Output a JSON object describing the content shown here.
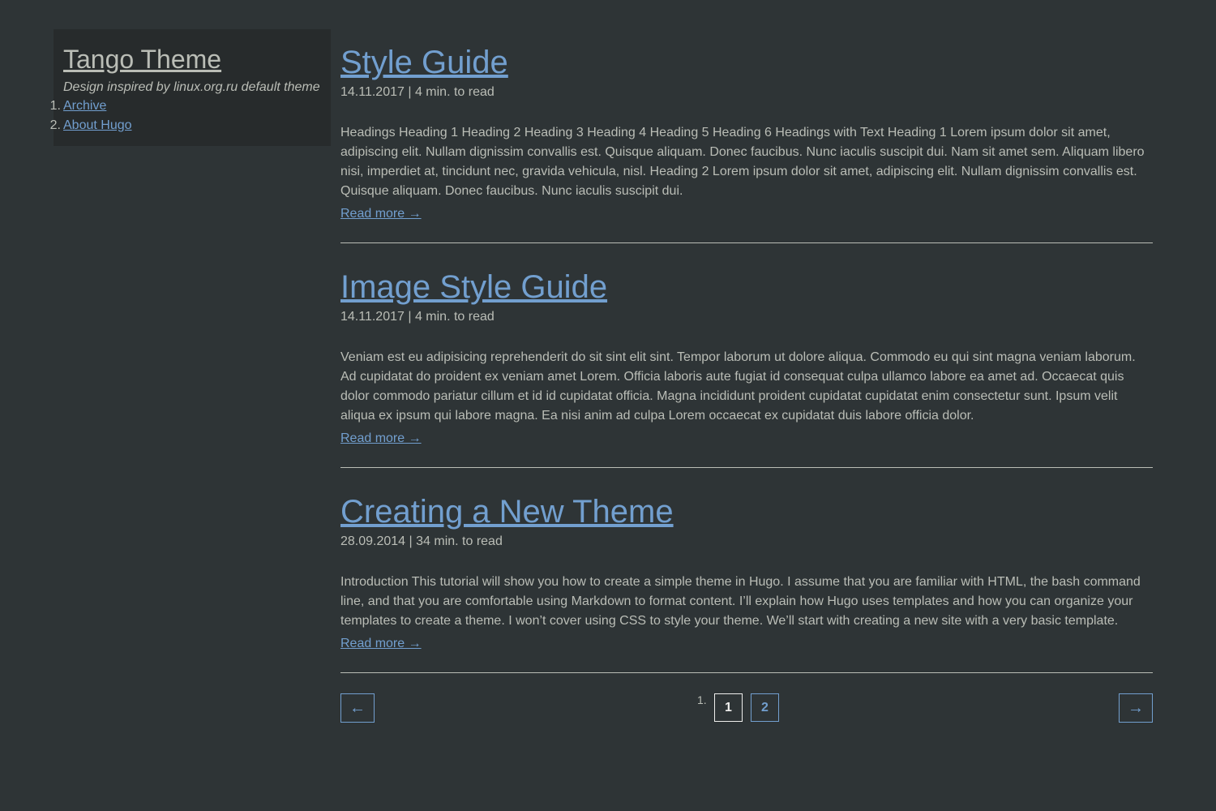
{
  "sidebar": {
    "title": "Tango Theme",
    "description": "Design inspired by linux.org.ru default theme",
    "nav": [
      {
        "number": "1.",
        "label": "Archive"
      },
      {
        "number": "2.",
        "label": "About Hugo"
      }
    ]
  },
  "posts": [
    {
      "title": "Style Guide",
      "meta": "14.11.2017 | 4 min. to read",
      "excerpt": "Headings Heading 1 Heading 2 Heading 3 Heading 4 Heading 5 Heading 6 Headings with Text Heading 1 Lorem ipsum dolor sit amet, adipiscing elit. Nullam dignissim convallis est. Quisque aliquam. Donec faucibus. Nunc iaculis suscipit dui. Nam sit amet sem. Aliquam libero nisi, imperdiet at, tincidunt nec, gravida vehicula, nisl. Heading 2 Lorem ipsum dolor sit amet, adipiscing elit. Nullam dignissim convallis est. Quisque aliquam. Donec faucibus. Nunc iaculis suscipit dui.",
      "read_more": "Read more →"
    },
    {
      "title": "Image Style Guide",
      "meta": "14.11.2017 | 4 min. to read",
      "excerpt": "Veniam est eu adipisicing reprehenderit do sit sint elit sint. Tempor laborum ut dolore aliqua. Commodo eu qui sint magna veniam laborum. Ad cupidatat do proident ex veniam amet Lorem. Officia laboris aute fugiat id consequat culpa ullamco labore ea amet ad. Occaecat quis dolor commodo pariatur cillum et id id cupidatat officia. Magna incididunt proident cupidatat cupidatat enim consectetur sunt. Ipsum velit aliqua ex ipsum qui labore magna. Ea nisi anim ad culpa Lorem occaecat ex cupidatat duis labore officia dolor.",
      "read_more": "Read more →"
    },
    {
      "title": "Creating a New Theme",
      "meta": "28.09.2014 | 34 min. to read",
      "excerpt": "Introduction This tutorial will show you how to create a simple theme in Hugo. I assume that you are familiar with HTML, the bash command line, and that you are comfortable using Markdown to format content. I’ll explain how Hugo uses templates and how you can organize your templates to create a theme. I won’t cover using CSS to style your theme. We’ll start with creating a new site with a very basic template.",
      "read_more": "Read more →"
    }
  ],
  "pagination": {
    "prev": "←",
    "next": "→",
    "list_marker": "1.",
    "pages": [
      "1",
      "2"
    ],
    "current": "1"
  },
  "colors": {
    "background": "#2e3436",
    "sidebar_bg": "#272b2c",
    "text": "#babdb6",
    "link": "#729fcf"
  }
}
